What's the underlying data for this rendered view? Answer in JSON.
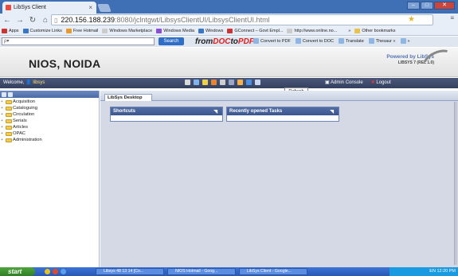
{
  "browser": {
    "tab_title": "LibSys Client",
    "tab_close": "×",
    "url_host": "220.156.188.239",
    "url_rest": ":8080/jclntgwt/LibsysClientUI/LibsysClientUI.html",
    "bookmarks": [
      {
        "label": "Apps",
        "color": "#c33"
      },
      {
        "label": "Customize Links",
        "color": "#3a76c7"
      },
      {
        "label": "Free Hotmail",
        "color": "#e79a2a"
      },
      {
        "label": "Windows Marketplace",
        "color": "#ccc"
      },
      {
        "label": "Windows Media",
        "color": "#8a4ed6"
      },
      {
        "label": "Windows",
        "color": "#3a76c7"
      },
      {
        "label": "GConnect – Govt Empl...",
        "color": "#c33"
      },
      {
        "label": "http://www.online.no...",
        "color": "#ccc"
      },
      {
        "label": "»",
        "color": "transparent"
      },
      {
        "label": "Other bookmarks",
        "color": "#e8c24a"
      }
    ]
  },
  "toolbar": {
    "search_placeholder": "ρ▾",
    "search_button": "Search",
    "logo_from": "from",
    "logo_doc": "DOC",
    "logo_to": "to",
    "logo_pdf": "PDF",
    "items": [
      "Convert to PDF",
      "Convert to DOC",
      "Translate",
      "Thesaur «",
      "»"
    ]
  },
  "app": {
    "institution": "NIOS, NOIDA",
    "powered_by": "Powered by LibSys",
    "version": "LIBSYS 7 (REL 1.0)",
    "welcome_prefix": "Welcome,",
    "username": "libsys",
    "admin_console": "Admin Console",
    "logout": "Logout",
    "tooltip": "Refresh",
    "nav_icon_colors": [
      "#d9d9d9",
      "#7fb3ea",
      "#f2d046",
      "#e6842f",
      "#cfcfcf",
      "#9aa7c4",
      "#f5b24a",
      "#4d8fe0",
      "#c7d6f0"
    ]
  },
  "tree": [
    {
      "label": "Acquisition"
    },
    {
      "label": "Cataloguing"
    },
    {
      "label": "Circulation"
    },
    {
      "label": "Serials"
    },
    {
      "label": "Articles"
    },
    {
      "label": "OPAC"
    },
    {
      "label": "Administration"
    }
  ],
  "main": {
    "tab_label": "LibSys Desktop",
    "portlets": [
      {
        "title": "Shortcuts"
      },
      {
        "title": "Recently opened Tasks"
      }
    ]
  },
  "taskbar": {
    "start": "start",
    "tasks": [
      "Libsys 48 13 14 [Co...",
      "NIOS Hotmail - Goog...",
      "LibSys Client - Google..."
    ],
    "tray_time": "12:20 PM",
    "tray_lang": "EN"
  }
}
